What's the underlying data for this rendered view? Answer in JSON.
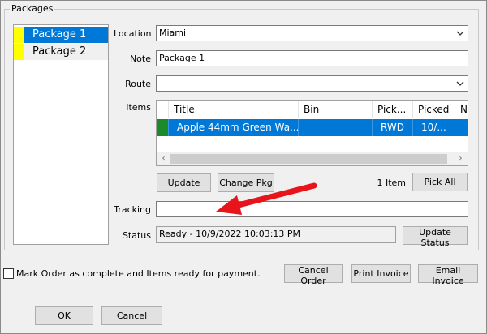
{
  "packages": {
    "group_title": "Packages",
    "items": [
      {
        "label": "Package 1",
        "selected": true,
        "color": "#ffff00"
      },
      {
        "label": "Package 2",
        "selected": false,
        "color": "#ffff00"
      }
    ]
  },
  "form": {
    "location_label": "Location",
    "location_value": "Miami",
    "note_label": "Note",
    "note_value": "Package 1",
    "route_label": "Route",
    "route_value": "",
    "items_label": "Items",
    "tracking_label": "Tracking",
    "tracking_value": "",
    "status_label": "Status",
    "status_value": "Ready - 10/9/2022 10:03:13 PM"
  },
  "items_grid": {
    "columns": [
      "Title",
      "Bin",
      "Pick...",
      "Picked",
      "No"
    ],
    "rows": [
      {
        "title": "Apple 44mm Green Wa...",
        "bin": "",
        "pick": "RWD",
        "picked": "10/...",
        "no": ""
      }
    ],
    "count_text": "1 Item"
  },
  "buttons": {
    "update": "Update",
    "change_pkg": "Change Pkg",
    "pick_all": "Pick All",
    "update_status": "Update Status",
    "cancel_order": "Cancel Order",
    "print_invoice": "Print Invoice",
    "email_invoice": "Email Invoice",
    "ok": "OK",
    "cancel": "Cancel"
  },
  "footer": {
    "mark_complete_label": "Mark Order as complete and Items ready for payment.",
    "mark_complete_checked": false
  },
  "colors": {
    "selection": "#0078d7",
    "annotation_arrow": "#e8141b"
  },
  "icons": {
    "dropdown": "chevron-down-icon",
    "scroll_left": "chevron-left-icon",
    "scroll_right": "chevron-right-icon"
  }
}
